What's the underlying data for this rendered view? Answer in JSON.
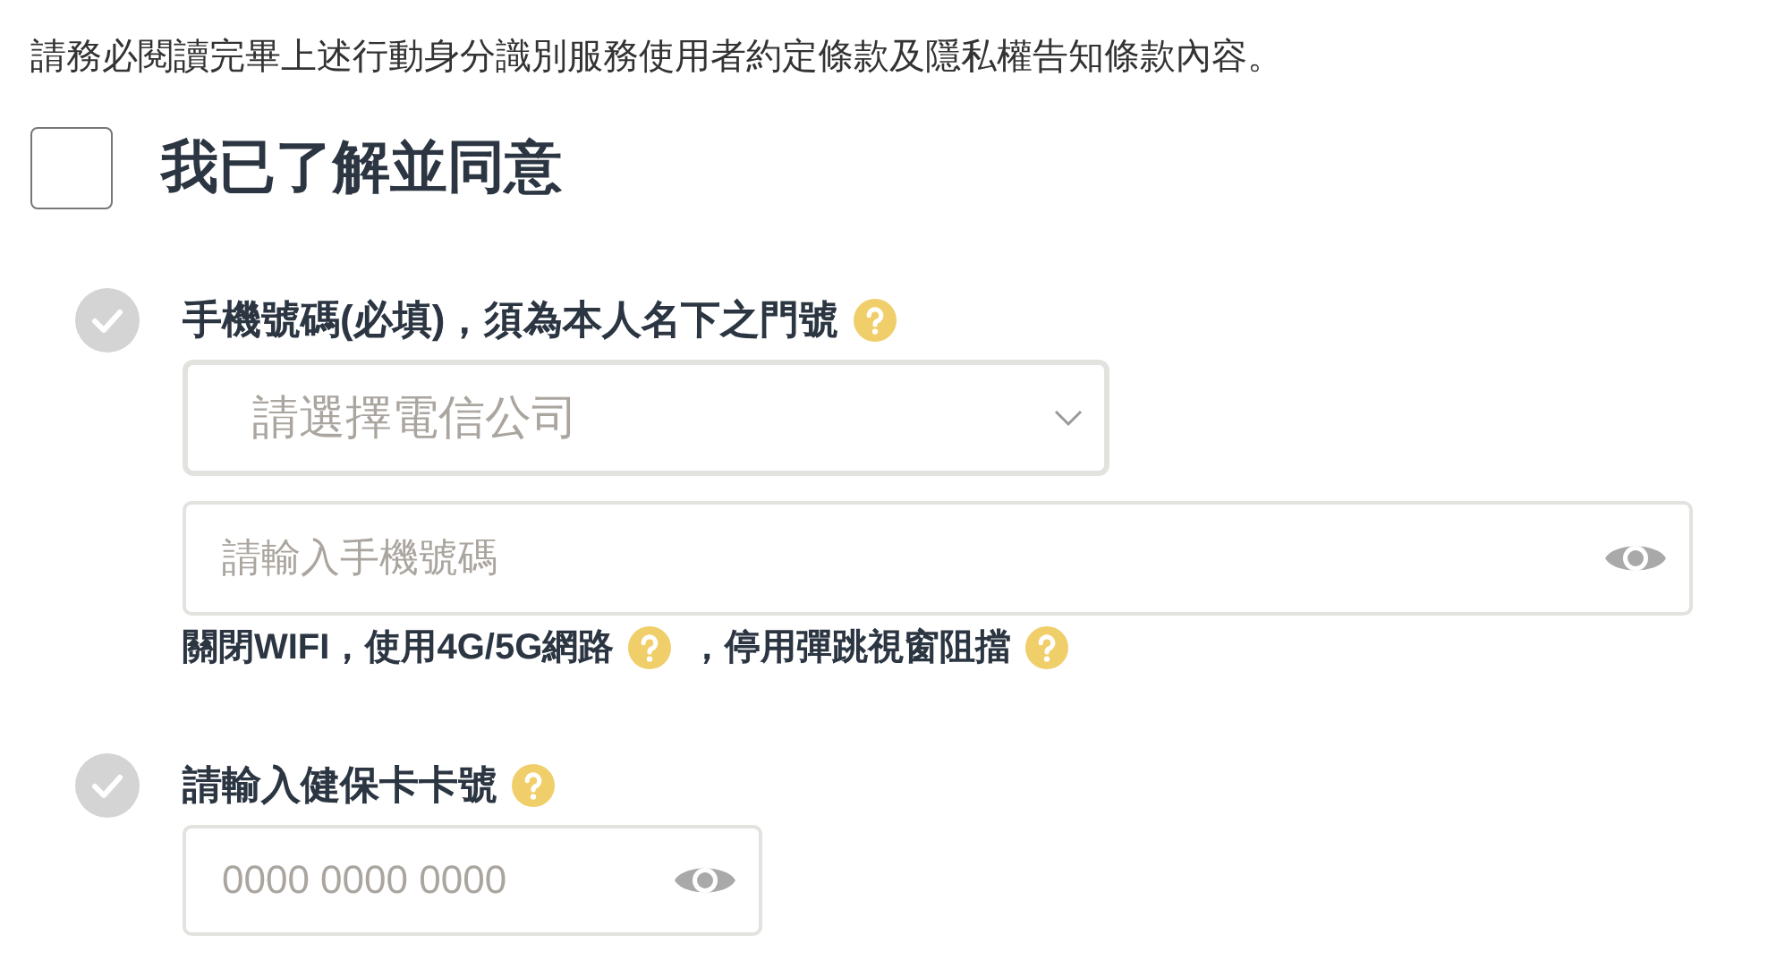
{
  "notice": "請務必閱讀完畢上述行動身分識別服務使用者約定條款及隱私權告知條款內容。",
  "agree": {
    "label": "我已了解並同意",
    "checked": false
  },
  "steps": [
    {
      "label": "手機號碼(必填)，須為本人名下之門號",
      "done": false,
      "help": true,
      "fields": [
        {
          "kind": "select",
          "placeholder": "請選擇電信公司"
        },
        {
          "kind": "secret",
          "placeholder": "請輸入手機號碼"
        }
      ],
      "notes": [
        {
          "text": "關閉WIFI，使用4G/5G網路",
          "help": true
        },
        {
          "text": "，停用彈跳視窗阻擋",
          "help": true
        }
      ]
    },
    {
      "label": "請輸入健保卡卡號",
      "done": false,
      "help": true,
      "fields": [
        {
          "kind": "secret-short",
          "placeholder": "0000 0000 0000"
        }
      ]
    }
  ]
}
